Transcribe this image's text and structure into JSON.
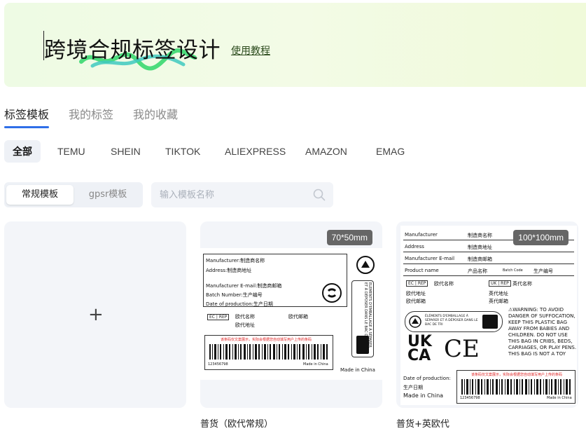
{
  "hero": {
    "title": "跨境合规标签设计",
    "link": "使用教程"
  },
  "tabs": [
    {
      "label": "标签模板",
      "active": true
    },
    {
      "label": "我的标签",
      "active": false
    },
    {
      "label": "我的收藏",
      "active": false
    }
  ],
  "platforms": [
    "全部",
    "TEMU",
    "SHEIN",
    "TIKTOK",
    "ALIEXPRESS",
    "AMAZON",
    "EMAG"
  ],
  "segment": {
    "regular": "常规模板",
    "gpsr": "gpsr模板"
  },
  "search": {
    "placeholder": "输入模板名称"
  },
  "add_card": {
    "symbol": "+"
  },
  "templates": [
    {
      "size": "70*50mm",
      "title": "普货（欧代常规）",
      "preview": {
        "manufacturer": "Manufacturer:制造商名称",
        "address": "Address:制造商地址",
        "email": "Manufacturer E-mail:制造商邮箱",
        "batch": "Batch Number:生产编号",
        "date": "Date of production:生产日期",
        "ec": "EC",
        "rep": "REP",
        "eu_name": "欧代名称",
        "eu_email": "欧代邮箱",
        "eu_address": "欧代地址",
        "barcode_note": "该条码仅文案展示，实际会根据您自动填写用户上传的条码",
        "barcode_num": "123456798",
        "made_in": "Made in China",
        "made_in_big": "Made in China",
        "triman": "ELEMENTS D'EMBALLAGE À SÉPARER ET À DÉPOSER DANS LE BAC DE TRI"
      }
    },
    {
      "size": "100*100mm",
      "title": "普货+英欧代",
      "preview": {
        "rows": [
          [
            "Manufacturer",
            "制造商名称"
          ],
          [
            "Address",
            "制造商地址"
          ],
          [
            "Manufacturer E-mail",
            "制造商邮箱"
          ]
        ],
        "product_name": "Product name",
        "product_name_v": "产品名称",
        "batch_code": "Batch Code",
        "batch_code_v": "生产编号",
        "ec": "EC",
        "rep": "REP",
        "eu_name": "欧代名称",
        "eu_address": "欧代地址",
        "eu_email": "欧代邮箱",
        "uk": "UK",
        "uk_rep": "REP",
        "uk_name": "英代名称",
        "uk_address": "英代地址",
        "uk_email": "英代邮箱",
        "triman": "ÉLÉMENTS D'EMBALLAGE À SÉPARER ET À DÉPOSER DANS LE BAC DE TRI",
        "warning": "⚠WARNING: TO AVOID DANGER OF SUFFOCATION, KEEP THIS PLASTIC BAG AWAY FROM BABIES AND CHILDREN. DO NOT USE THIS BAG IN CRIBS, BEDS, CARRIAGES, OR PLAY PENS. THIS BAG IS NOT A TOY",
        "ukca": "UK CA",
        "ce": "CE",
        "date_label": "Date of production:",
        "date_value": "生产日期",
        "made_in": "Made in China",
        "barcode_note": "该条码仅文案展示，实际会根据您自动填写用户上传的条码",
        "barcode_num": "123456798",
        "barcode_made": "Made in China"
      }
    }
  ],
  "colors": {
    "accent": "#2f6fe8",
    "hero_bg": "#eefbe4",
    "badge": "#666666",
    "squiggle_green": "#4cdc7c",
    "squiggle_teal": "#3fc9c0"
  }
}
